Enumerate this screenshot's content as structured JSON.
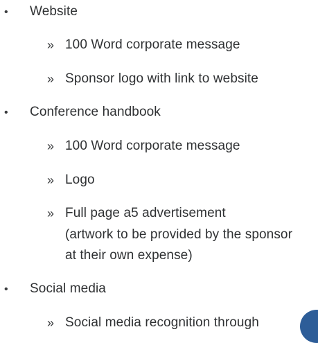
{
  "bullet_glyph": "•",
  "sub_glyph": "»",
  "sections": [
    {
      "title": "Website",
      "items": [
        {
          "lines": [
            "100 Word corporate message"
          ]
        },
        {
          "lines": [
            "Sponsor logo with link to website"
          ]
        }
      ]
    },
    {
      "title": "Conference handbook",
      "items": [
        {
          "lines": [
            "100 Word corporate message"
          ]
        },
        {
          "lines": [
            "Logo"
          ]
        },
        {
          "lines": [
            "Full page a5 advertisement",
            "(artwork to be provided by the sponsor",
            "at their own expense)"
          ]
        }
      ]
    },
    {
      "title": "Social media",
      "items": [
        {
          "lines": [
            "Social media recognition through"
          ]
        }
      ]
    }
  ],
  "colors": {
    "text": "#2f3133",
    "accent_circle": "#2d5d98"
  }
}
